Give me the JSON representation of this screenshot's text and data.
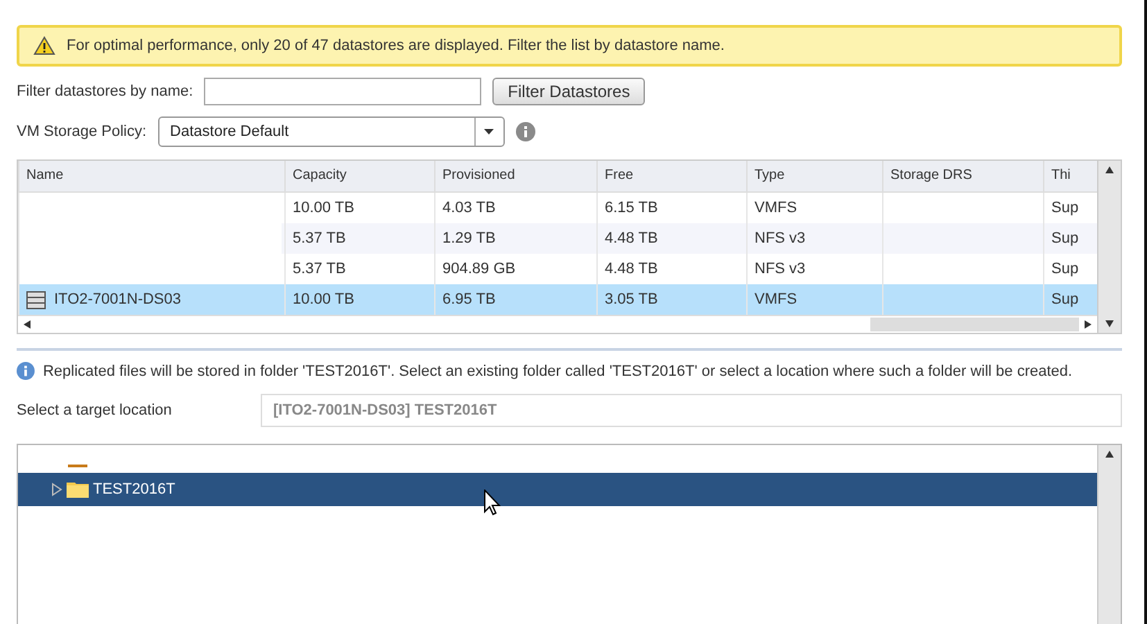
{
  "warning": {
    "text": "For optimal performance, only 20 of 47 datastores are displayed. Filter the list by datastore name."
  },
  "filter": {
    "label": "Filter datastores by name:",
    "button": "Filter Datastores"
  },
  "policy": {
    "label": "VM Storage Policy:",
    "value": "Datastore Default"
  },
  "table": {
    "columns": [
      "Name",
      "Capacity",
      "Provisioned",
      "Free",
      "Type",
      "Storage DRS",
      "Thi"
    ],
    "rows": [
      {
        "name": "",
        "capacity": "10.00 TB",
        "provisioned": "4.03 TB",
        "free": "6.15 TB",
        "type": "VMFS",
        "drs": "",
        "column_7": "Sup",
        "selected": false
      },
      {
        "name": "",
        "capacity": "5.37 TB",
        "provisioned": "1.29 TB",
        "free": "4.48 TB",
        "type": "NFS v3",
        "drs": "",
        "column_7": "Sup",
        "selected": false
      },
      {
        "name": "",
        "capacity": "5.37 TB",
        "provisioned": "904.89 GB",
        "free": "4.48 TB",
        "type": "NFS v3",
        "drs": "",
        "column_7": "Sup",
        "selected": false
      },
      {
        "name": "ITO2-7001N-DS03",
        "capacity": "10.00 TB",
        "provisioned": "6.95 TB",
        "free": "3.05 TB",
        "type": "VMFS",
        "drs": "",
        "column_7": "Sup",
        "selected": true
      }
    ]
  },
  "info": {
    "text": "Replicated files will be stored in folder 'TEST2016T'. Select an existing folder called 'TEST2016T' or select a location where such a folder will be created."
  },
  "target": {
    "label": "Select a target location",
    "value": "[ITO2-7001N-DS03] TEST2016T"
  },
  "tree": {
    "items": [
      {
        "label": "TEST2016T",
        "selected": true,
        "expanded": false
      }
    ]
  }
}
